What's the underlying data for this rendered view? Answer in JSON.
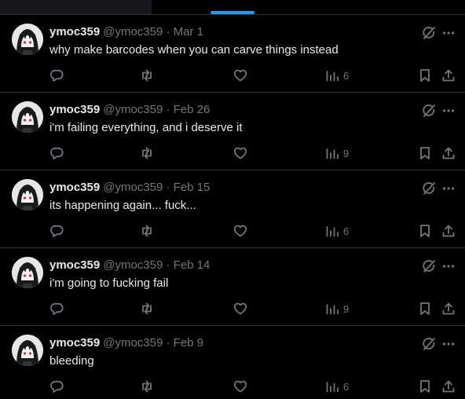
{
  "tabs": {
    "active_tab_color": "#1d9bf0"
  },
  "posts": [
    {
      "name": "ymoc359",
      "handle": "@ymoc359",
      "separator": "·",
      "date": "Mar 1",
      "text": "why make barcodes when you can carve things instead",
      "views": "6"
    },
    {
      "name": "ymoc359",
      "handle": "@ymoc359",
      "separator": "·",
      "date": "Feb 26",
      "text": "i'm failing everything, and i deserve it",
      "views": "9"
    },
    {
      "name": "ymoc359",
      "handle": "@ymoc359",
      "separator": "·",
      "date": "Feb 15",
      "text": "its happening again... fuck...",
      "views": "6"
    },
    {
      "name": "ymoc359",
      "handle": "@ymoc359",
      "separator": "·",
      "date": "Feb 14",
      "text": "i'm going to fucking fail",
      "views": "9"
    },
    {
      "name": "ymoc359",
      "handle": "@ymoc359",
      "separator": "·",
      "date": "Feb 9",
      "text": "bleeding",
      "views": "6"
    }
  ],
  "icons": {
    "grok": "grok-icon",
    "more": "more-dots-icon",
    "reply": "reply-icon",
    "repost": "repost-icon",
    "like": "heart-icon",
    "views": "views-chart-icon",
    "bookmark": "bookmark-icon",
    "share": "share-icon"
  }
}
